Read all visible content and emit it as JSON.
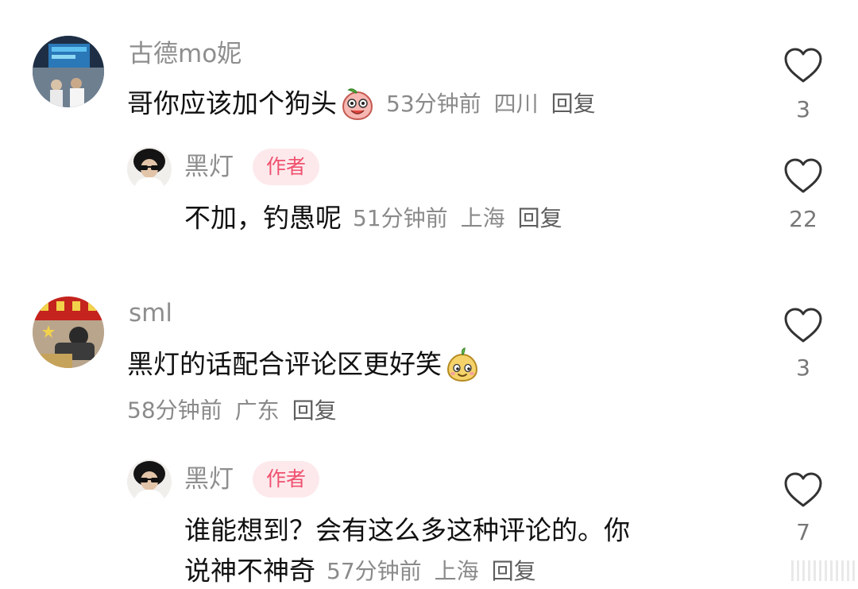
{
  "comments": [
    {
      "username": "古德mo妮",
      "text": "哥你应该加个狗头",
      "time": "53分钟前",
      "location": "四川",
      "reply_label": "回复",
      "likes": "3",
      "emoji": "peach-dog-head-emoji",
      "replies": [
        {
          "username": "黑灯",
          "badge": "作者",
          "text": "不加，钓愚呢",
          "time": "51分钟前",
          "location": "上海",
          "reply_label": "回复",
          "likes": "22"
        }
      ]
    },
    {
      "username": "sml",
      "text": "黑灯的话配合评论区更好笑",
      "time": "58分钟前",
      "location": "广东",
      "reply_label": "回复",
      "likes": "3",
      "emoji": "smirk-face-emoji",
      "replies": [
        {
          "username": "黑灯",
          "badge": "作者",
          "text_line1": "谁能想到？会有这么多这种评论的。你",
          "text_line2": "说神不神奇",
          "time": "57分钟前",
          "location": "上海",
          "reply_label": "回复",
          "likes": "7"
        }
      ]
    }
  ],
  "colors": {
    "background": "#ffffff",
    "username": "#8e8e8e",
    "text": "#111111",
    "meta": "#8a8a8a",
    "author_badge_bg": "#fde9ec",
    "author_badge_text": "#f0506e",
    "heart_outline": "#333333"
  },
  "icons": {
    "like": "heart-outline-icon"
  }
}
